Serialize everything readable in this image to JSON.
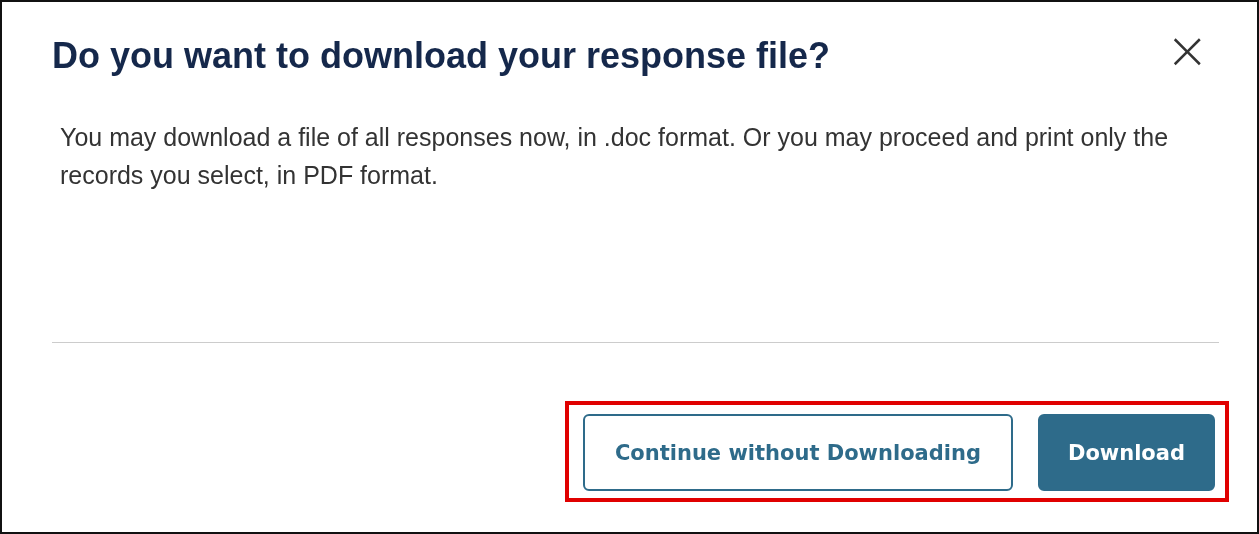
{
  "dialog": {
    "title": "Do you want to download your response file?",
    "close": "×",
    "message": "You may download a file of all responses now, in .doc format. Or you may proceed and print only the records you select, in PDF format.",
    "buttons_highlighted": true,
    "buttons": [
      {
        "label": "Continue without Downloading",
        "kind": "secondary"
      },
      {
        "label": "Download",
        "kind": "primary"
      }
    ]
  }
}
